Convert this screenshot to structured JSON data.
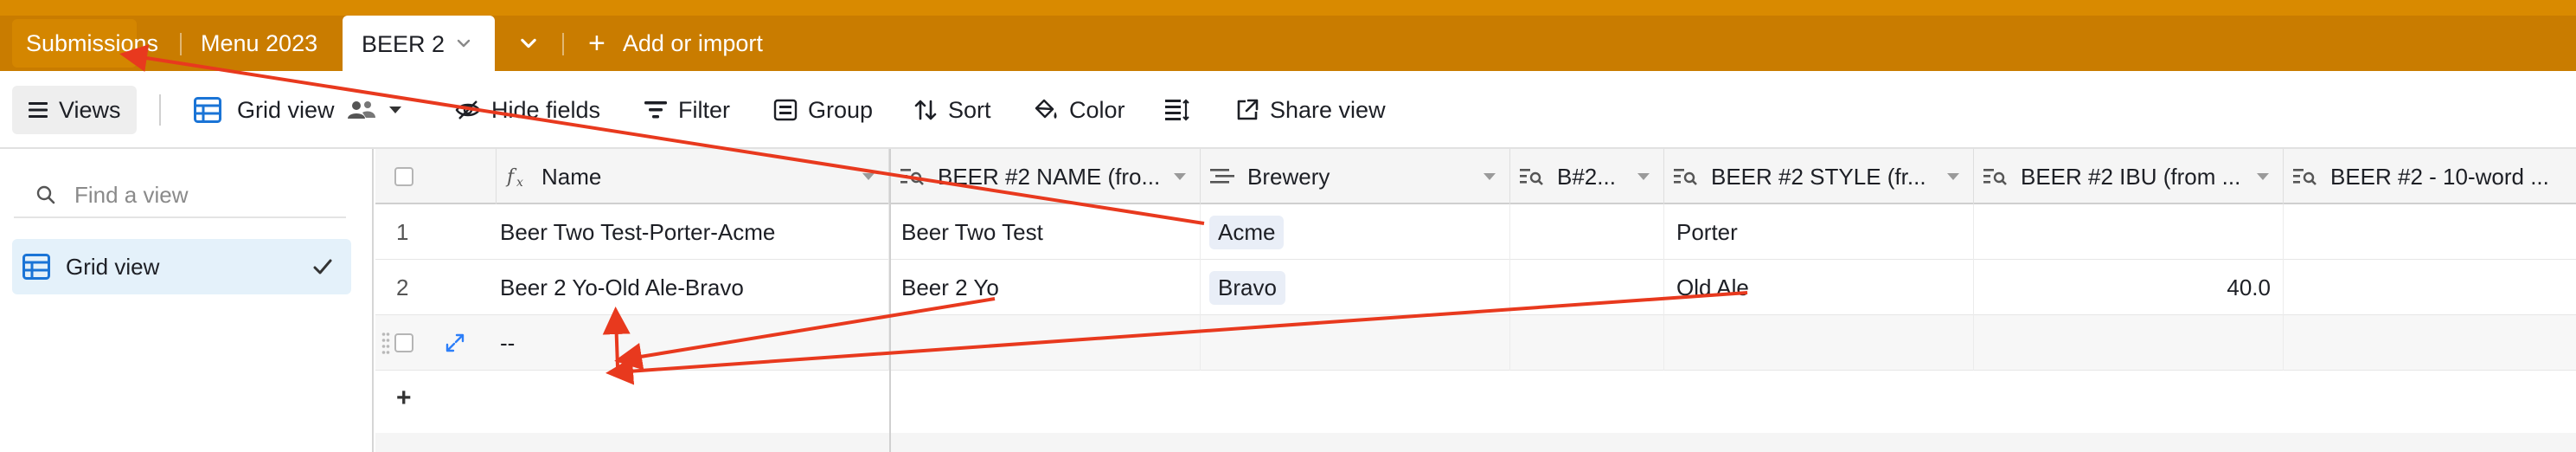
{
  "tabs": {
    "submissions": "Submissions",
    "menu": "Menu 2023",
    "active": "BEER 2",
    "add": "Add or import"
  },
  "toolbar": {
    "views": "Views",
    "grid_view": "Grid view",
    "hide_fields": "Hide fields",
    "filter": "Filter",
    "group": "Group",
    "sort": "Sort",
    "color": "Color",
    "share_view": "Share view"
  },
  "sidebar": {
    "find_placeholder": "Find a view",
    "items": [
      {
        "label": "Grid view",
        "selected": true
      }
    ]
  },
  "grid": {
    "columns": [
      {
        "label": "Name",
        "icon": "formula-icon"
      },
      {
        "label": "BEER #2 NAME (fro...",
        "icon": "lookup-icon"
      },
      {
        "label": "Brewery",
        "icon": "lookup-list-icon"
      },
      {
        "label": "B#2...",
        "icon": "lookup-icon"
      },
      {
        "label": "BEER #2 STYLE (fr...",
        "icon": "lookup-icon"
      },
      {
        "label": "BEER #2 IBU (from ...",
        "icon": "lookup-icon"
      },
      {
        "label": "BEER #2 - 10-word ...",
        "icon": "lookup-icon"
      }
    ],
    "rows": [
      {
        "num": "1",
        "name": "Beer Two Test-Porter-Acme",
        "beer_name": "Beer Two Test",
        "brewery": "Acme",
        "b2": "",
        "style": "Porter",
        "ibu": "",
        "desc": ""
      },
      {
        "num": "2",
        "name": "Beer 2 Yo-Old Ale-Bravo",
        "beer_name": "Beer 2 Yo",
        "brewery": "Bravo",
        "b2": "",
        "style": "Old Ale",
        "ibu": "40.0",
        "desc": ""
      }
    ],
    "new_row_name": "--",
    "add_row": "+"
  },
  "colors": {
    "tabbar": "#c97c00",
    "topstrip": "#d98a00",
    "selected_view_bg": "#e4f1fa",
    "accent_blue": "#2d7ff9",
    "annotation_red": "#e8391e"
  }
}
